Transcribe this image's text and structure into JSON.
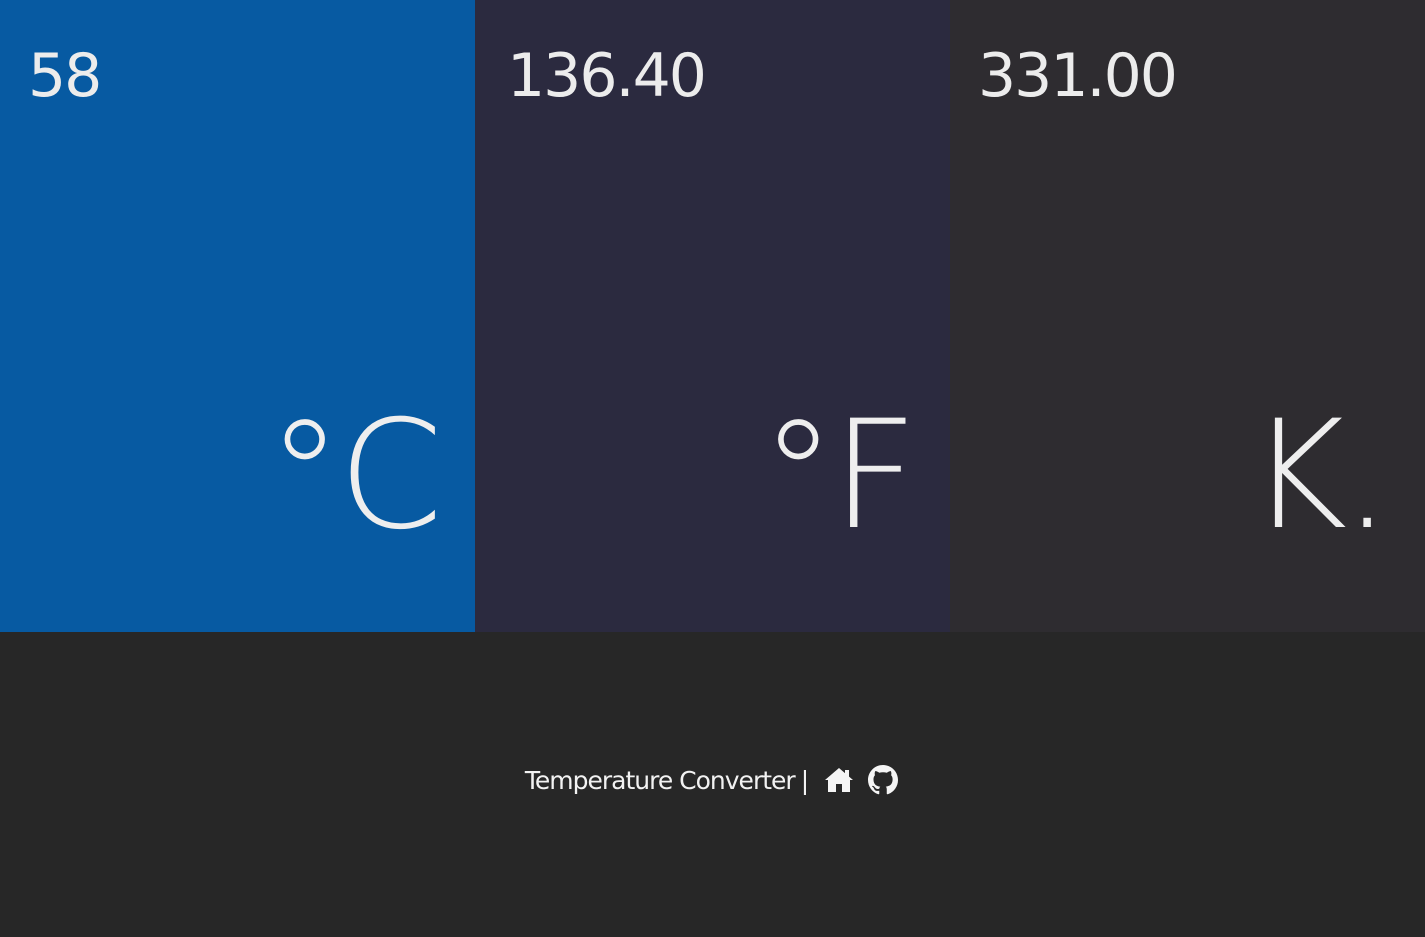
{
  "panels": {
    "celsius": {
      "value": "58",
      "unit": "°C",
      "color": "#075aa2"
    },
    "fahrenheit": {
      "value": "136.40",
      "unit": "°F",
      "color": "#2b2a3f"
    },
    "kelvin": {
      "value": "331.00",
      "unit": "K.",
      "color": "#2e2c30"
    }
  },
  "footer": {
    "title": "Temperature Converter",
    "separator": "|",
    "icons": [
      "home-icon",
      "github-icon"
    ]
  }
}
